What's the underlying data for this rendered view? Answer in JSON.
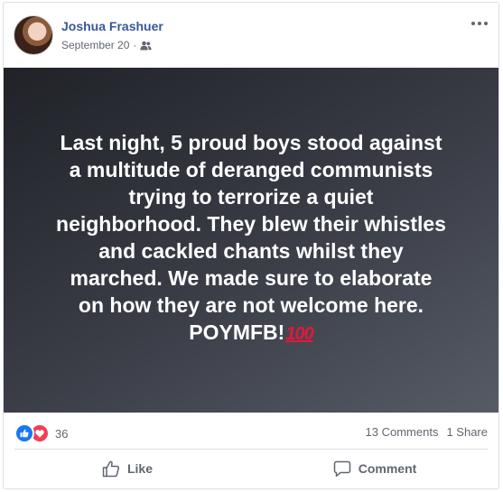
{
  "post": {
    "author": "Joshua Frashuer",
    "date": "September 20",
    "separator": "·",
    "audience_icon": "friends-icon",
    "text_lines": [
      "Last night, 5 proud boys stood against",
      "a multitude of deranged communists",
      "trying to terrorize a quiet",
      "neighborhood. They blew their whistles",
      "and cackled chants whilst they",
      "marched. We made sure to elaborate",
      "on how they are not welcome here."
    ],
    "last_line": "POYMFB!",
    "emoji": "100-emoji"
  },
  "stats": {
    "reaction_icons": [
      "like-reaction-icon",
      "love-reaction-icon"
    ],
    "reaction_count": "36",
    "comments": "13 Comments",
    "shares": "1 Share"
  },
  "actions": {
    "like_label": "Like",
    "comment_label": "Comment"
  },
  "colors": {
    "author_link": "#385898",
    "like_blue": "#1877f2",
    "love_red": "#f33e58",
    "text_gray": "#606770"
  }
}
